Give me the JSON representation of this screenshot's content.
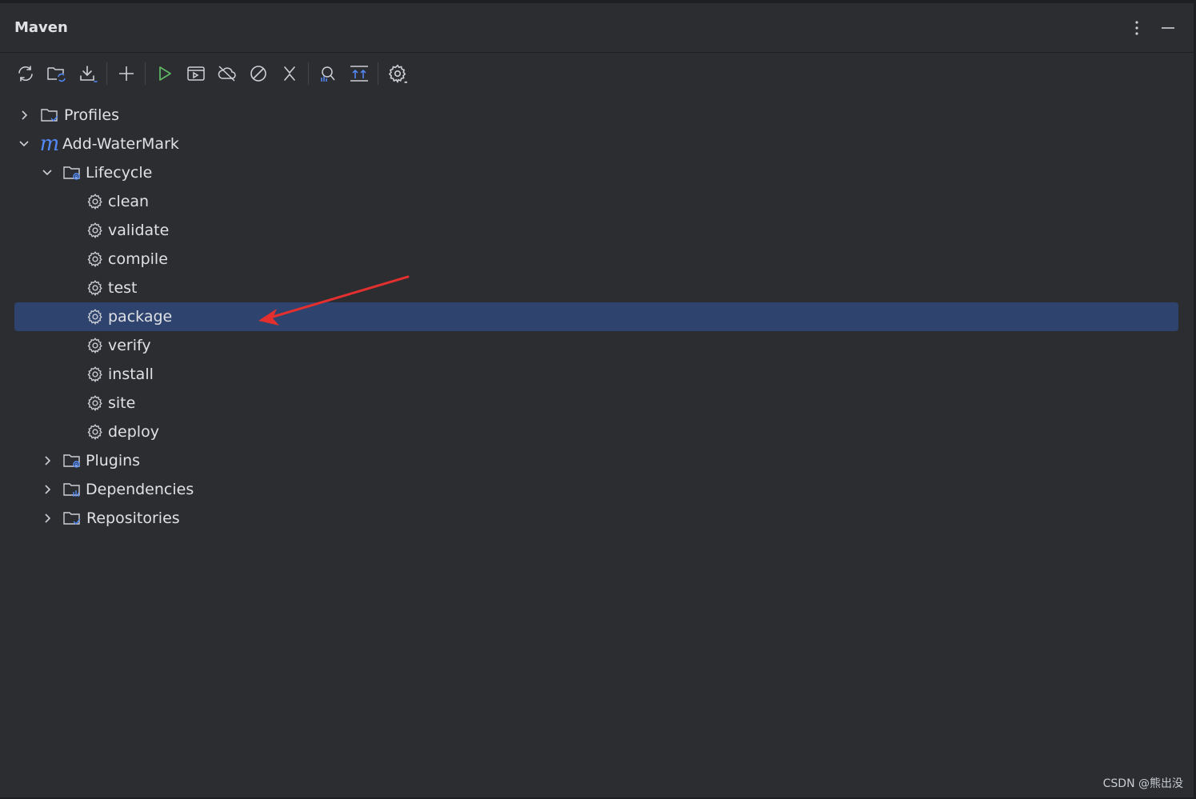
{
  "panel": {
    "title": "Maven",
    "header_icons": [
      "more-vertical-icon",
      "minimize-icon"
    ]
  },
  "toolbar": {
    "buttons": [
      {
        "icon": "reload-icon"
      },
      {
        "icon": "folder-sync-icon"
      },
      {
        "icon": "download-icon"
      },
      {
        "icon": "add-icon"
      },
      {
        "icon": "run-icon"
      },
      {
        "icon": "execute-goal-icon"
      },
      {
        "icon": "offline-cloud-icon"
      },
      {
        "icon": "skip-tests-icon"
      },
      {
        "icon": "collapse-icon"
      },
      {
        "icon": "analyze-dependencies-icon"
      },
      {
        "icon": "expand-all-icon"
      },
      {
        "icon": "settings-icon"
      }
    ]
  },
  "tree": {
    "profiles": "Profiles",
    "project": "Add-WaterMark",
    "lifecycle": "Lifecycle",
    "goals": [
      "clean",
      "validate",
      "compile",
      "test",
      "package",
      "verify",
      "install",
      "site",
      "deploy"
    ],
    "selected_goal": "package",
    "plugins": "Plugins",
    "dependencies": "Dependencies",
    "repositories": "Repositories"
  },
  "annotation": {
    "color": "#e3302f"
  },
  "colors": {
    "background": "#2b2d30",
    "selection": "#2e436e",
    "accent": "#548af7",
    "run": "#5fb865"
  },
  "watermark": "CSDN @熊出没"
}
